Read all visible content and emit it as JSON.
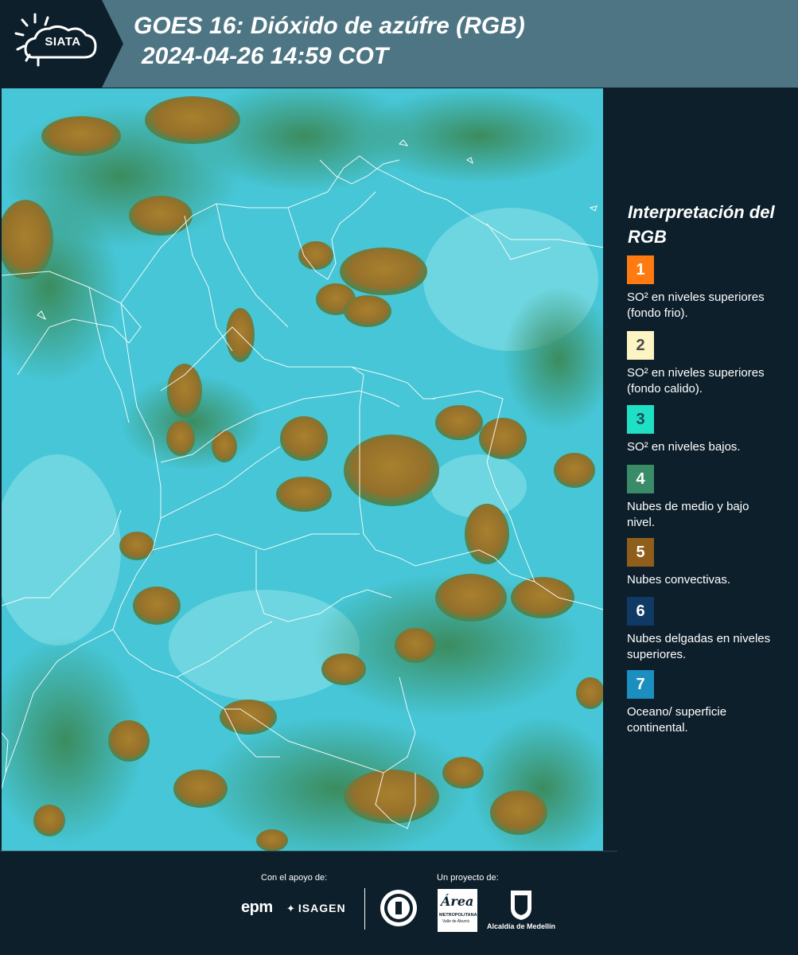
{
  "header": {
    "logo_text": "SIATA",
    "title": "GOES 16: Dióxido de azúfre (RGB)",
    "timestamp": "2024-04-26 14:59 COT",
    "background_color": "#4d7584"
  },
  "map": {
    "product": "RGB Dióxido de azufre",
    "background_color": "#46c6d6",
    "cloud_color": "#a27a2c",
    "boundary_color": "#ffffff"
  },
  "legend": {
    "title": "Interpretación del RGB",
    "items": [
      {
        "number": "1",
        "label": "SO² en niveles superiores (fondo frio).",
        "color": "#ff7a10",
        "text_color": "#ffffff"
      },
      {
        "number": "2",
        "label": "SO² en niveles superiores (fondo calido).",
        "color": "#fdf4c4",
        "text_color": "#4a4a4a"
      },
      {
        "number": "3",
        "label": "SO² en niveles bajos.",
        "color": "#1fe0c4",
        "text_color": "#1a4a5a"
      },
      {
        "number": "4",
        "label": "Nubes de medio y bajo nivel.",
        "color": "#3a8c68",
        "text_color": "#ffffff"
      },
      {
        "number": "5",
        "label": "Nubes convectivas.",
        "color": "#8e5e1a",
        "text_color": "#ffffff"
      },
      {
        "number": "6",
        "label": "Nubes delgadas en niveles superiores.",
        "color": "#0f3a66",
        "text_color": "#ffffff"
      },
      {
        "number": "7",
        "label": "Oceano/ superficie continental.",
        "color": "#1a8fc0",
        "text_color": "#ffffff"
      }
    ]
  },
  "footer": {
    "support_label": "Con el apoyo de:",
    "project_label": "Un proyecto de:",
    "sponsors": [
      "epm",
      "ISAGEN"
    ],
    "partners": [
      "Área Metropolitana Valle de Aburrá",
      "Alcaldía de Medellín"
    ],
    "epm_text": "epm",
    "isagen_text": "ISAGEN",
    "area_text": "Área",
    "area_sub1": "METROPOLITANA",
    "area_sub2": "Valle de Aburrá",
    "alcaldia_text": "Alcaldía de Medellín"
  }
}
